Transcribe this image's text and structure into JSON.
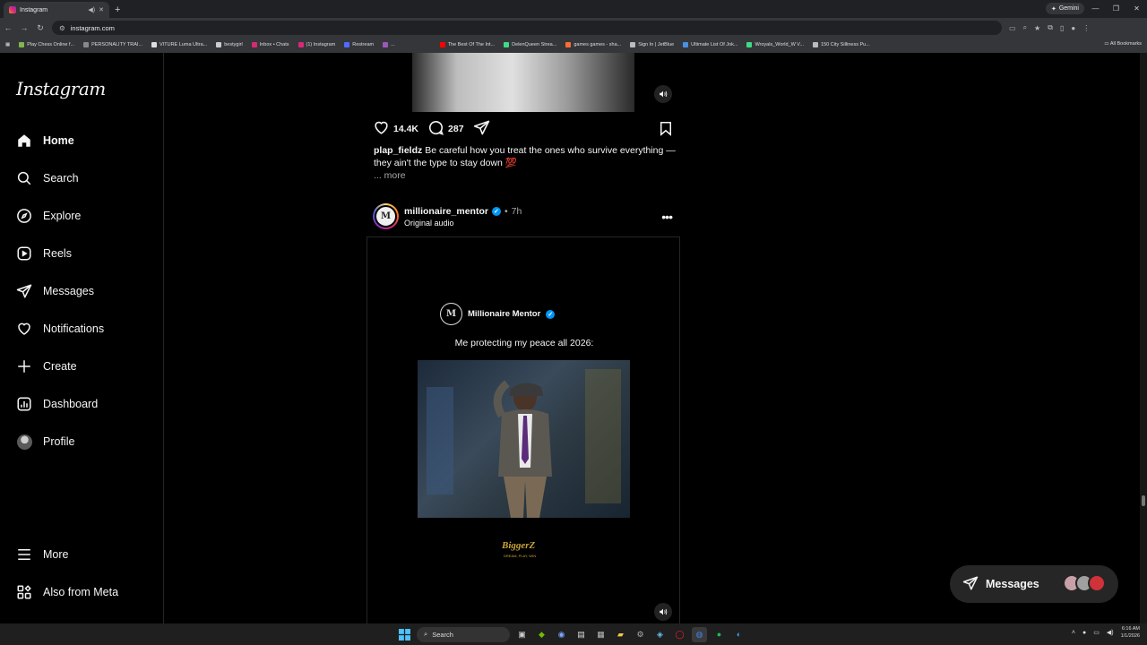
{
  "browser": {
    "tab_title": "Instagram",
    "new_tab": "+",
    "gemini_label": "Gemini",
    "url": "instagram.com",
    "bookmarks": [
      {
        "label": "Play Chess Online f...",
        "color": "#81b64c"
      },
      {
        "label": "PERSONALITY TRAI...",
        "color": "#888888"
      },
      {
        "label": "VITURE Luma Ultra...",
        "color": "#dddddd"
      },
      {
        "label": "bestygirl",
        "color": "#cccccc"
      },
      {
        "label": "Inbox • Chats",
        "color": "#d62976"
      },
      {
        "label": "(1) Instagram",
        "color": "#d62976"
      },
      {
        "label": "Restream",
        "color": "#4f6bff"
      },
      {
        "label": "...",
        "color": "#9b59b6"
      },
      {
        "label": "The Best Of The Int...",
        "color": "#ff0000"
      },
      {
        "label": "DelenQueen Strea...",
        "color": "#3ddc84"
      },
      {
        "label": "games games - sha...",
        "color": "#ff6b35"
      },
      {
        "label": "Sign In | JetBlue",
        "color": "#bbbbbb"
      },
      {
        "label": "Ultimate List Of Jok...",
        "color": "#4a90e2"
      },
      {
        "label": "Wroyals_World_W V...",
        "color": "#3ddc84"
      },
      {
        "label": "150 City Silliness Pu...",
        "color": "#bbbbbb"
      }
    ],
    "all_bookmarks": "All Bookmarks"
  },
  "sidebar": {
    "logo": "Instagram",
    "items": [
      {
        "label": "Home",
        "icon": "home-icon"
      },
      {
        "label": "Search",
        "icon": "search-icon"
      },
      {
        "label": "Explore",
        "icon": "explore-icon"
      },
      {
        "label": "Reels",
        "icon": "reels-icon"
      },
      {
        "label": "Messages",
        "icon": "messages-icon"
      },
      {
        "label": "Notifications",
        "icon": "heart-icon"
      },
      {
        "label": "Create",
        "icon": "plus-icon"
      },
      {
        "label": "Dashboard",
        "icon": "dashboard-icon"
      },
      {
        "label": "Profile",
        "icon": "avatar"
      }
    ],
    "more": "More",
    "also_from_meta": "Also from Meta"
  },
  "post1": {
    "likes": "14.4K",
    "comments": "287",
    "username": "plap_fieldz",
    "caption": "Be careful how you treat the ones who survive everything — they ain't the type to stay down",
    "emoji": "💯",
    "more": "... more"
  },
  "post2": {
    "username": "millionaire_mentor",
    "separator": "•",
    "time": "7h",
    "audio": "Original audio",
    "overlay_account": "Millionaire Mentor",
    "overlay_text": "Me protecting my peace all 2026:",
    "watermark": "BiggerZ",
    "watermark_sub": "DREAM, PLAY, WIN",
    "avatar_initial": "M"
  },
  "messages_pill": {
    "label": "Messages"
  },
  "taskbar": {
    "search": "Search",
    "time": "6:16 AM",
    "date": "1/1/2026"
  }
}
